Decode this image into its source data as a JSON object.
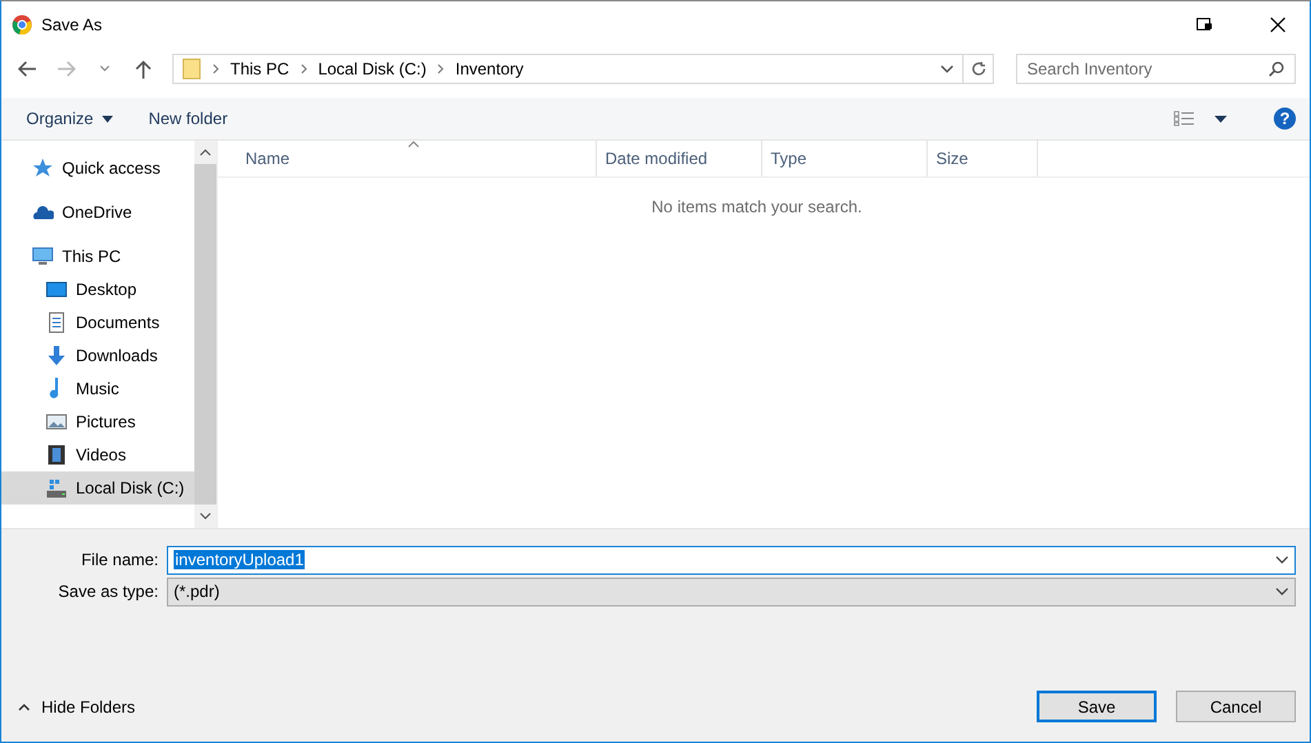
{
  "window": {
    "title": "Save As"
  },
  "address": {
    "path": [
      "This PC",
      "Local Disk (C:)",
      "Inventory"
    ]
  },
  "search": {
    "placeholder": "Search Inventory"
  },
  "toolbar": {
    "organize": "Organize",
    "new_folder": "New folder",
    "help": "?"
  },
  "navigation": [
    {
      "label": "Quick access",
      "kind": "quick",
      "selected": false
    },
    {
      "label": "OneDrive",
      "kind": "cloud",
      "selected": false
    },
    {
      "label": "This PC",
      "kind": "pc",
      "selected": false,
      "children": [
        {
          "label": "Desktop",
          "kind": "desktop",
          "selected": false
        },
        {
          "label": "Documents",
          "kind": "documents",
          "selected": false
        },
        {
          "label": "Downloads",
          "kind": "downloads",
          "selected": false
        },
        {
          "label": "Music",
          "kind": "music",
          "selected": false
        },
        {
          "label": "Pictures",
          "kind": "pictures",
          "selected": false
        },
        {
          "label": "Videos",
          "kind": "videos",
          "selected": false
        },
        {
          "label": "Local Disk (C:)",
          "kind": "disk",
          "selected": true
        }
      ]
    }
  ],
  "file_list": {
    "columns": [
      "Name",
      "Date modified",
      "Type",
      "Size"
    ],
    "empty_message": "No items match your search."
  },
  "file_name": {
    "label": "File name:",
    "value": "inventoryUpload1"
  },
  "save_as_type": {
    "label": "Save as type:",
    "value": "(*.pdr)"
  },
  "hide_folders": "Hide Folders",
  "buttons": [
    {
      "label": "Save",
      "kind": "primary"
    },
    {
      "label": "Cancel",
      "kind": "secondary"
    }
  ]
}
